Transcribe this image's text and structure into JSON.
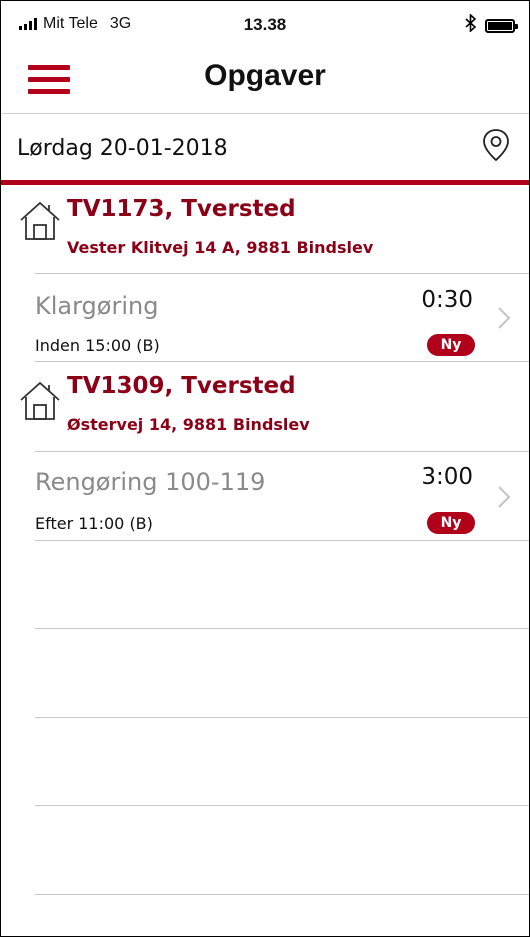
{
  "status_bar": {
    "carrier": "Mit Tele",
    "network": "3G",
    "time": "13.38",
    "bluetooth_icon": "bluetooth-icon",
    "battery_icon": "battery-icon"
  },
  "header": {
    "title": "Opgaver",
    "menu_icon": "hamburger-menu-icon"
  },
  "date_bar": {
    "date": "Lørdag 20-01-2018",
    "location_icon": "location-pin-icon"
  },
  "colors": {
    "accent": "#b0001a",
    "title_red": "#8b0016",
    "task_gray": "#8a8a8a"
  },
  "groups": [
    {
      "title": "TV1173, Tversted",
      "address": "Vester Klitvej 14 A, 9881 Bindslev",
      "icon": "house-icon",
      "tasks": [
        {
          "name": "Klargøring",
          "duration": "0:30",
          "deadline": "Inden 15:00 (B)",
          "badge": "Ny"
        }
      ]
    },
    {
      "title": "TV1309, Tversted",
      "address": "Østervej 14, 9881 Bindslev",
      "icon": "house-icon",
      "tasks": [
        {
          "name": "Rengøring 100-119",
          "duration": "3:00",
          "deadline": "Efter 11:00 (B)",
          "badge": "Ny"
        }
      ]
    }
  ]
}
